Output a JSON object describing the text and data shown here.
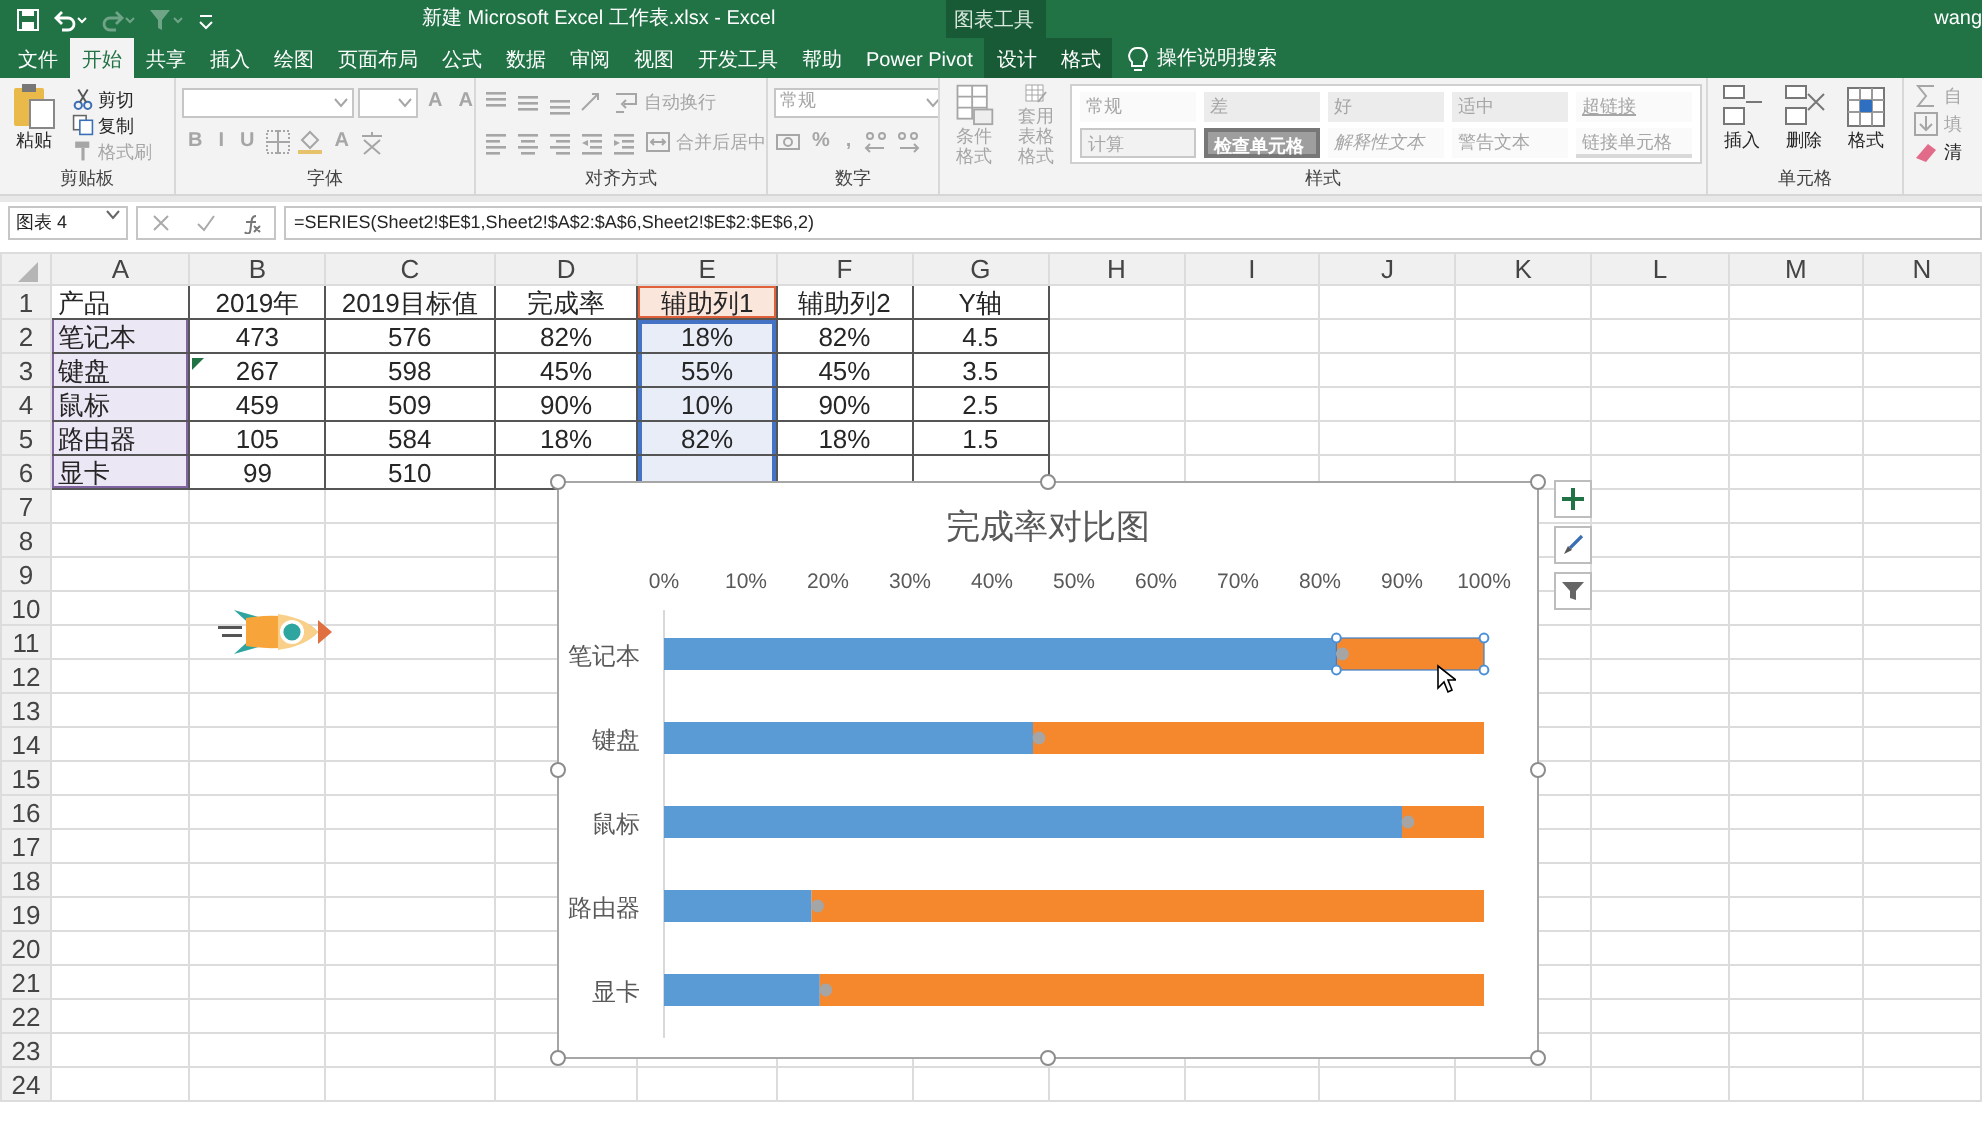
{
  "title_bar": {
    "title": "新建 Microsoft Excel 工作表.xlsx  -  Excel",
    "context_group": "图表工具",
    "user": "wang"
  },
  "quick_access": [
    {
      "kind": "save",
      "disabled": false
    },
    {
      "kind": "undo",
      "disabled": false
    },
    {
      "kind": "redo",
      "disabled": true
    },
    {
      "kind": "filter",
      "disabled": true
    },
    {
      "kind": "customize",
      "disabled": false
    }
  ],
  "tabs": [
    {
      "label": "文件",
      "selected": false,
      "contextual": false
    },
    {
      "label": "开始",
      "selected": true,
      "contextual": false
    },
    {
      "label": "共享",
      "selected": false,
      "contextual": false
    },
    {
      "label": "插入",
      "selected": false,
      "contextual": false
    },
    {
      "label": "绘图",
      "selected": false,
      "contextual": false
    },
    {
      "label": "页面布局",
      "selected": false,
      "contextual": false
    },
    {
      "label": "公式",
      "selected": false,
      "contextual": false
    },
    {
      "label": "数据",
      "selected": false,
      "contextual": false
    },
    {
      "label": "审阅",
      "selected": false,
      "contextual": false
    },
    {
      "label": "视图",
      "selected": false,
      "contextual": false
    },
    {
      "label": "开发工具",
      "selected": false,
      "contextual": false
    },
    {
      "label": "帮助",
      "selected": false,
      "contextual": false
    },
    {
      "label": "Power Pivot",
      "selected": false,
      "contextual": false
    },
    {
      "label": "设计",
      "selected": false,
      "contextual": true
    },
    {
      "label": "格式",
      "selected": false,
      "contextual": true
    }
  ],
  "search": {
    "label": "操作说明搜索"
  },
  "ribbon": [
    {
      "label": "剪贴板",
      "blocks": [
        {
          "kind": "large",
          "label": "粘贴",
          "disabled": false
        },
        {
          "kind": "stack",
          "rows": [
            [
              {
                "kind": "small",
                "label": "剪切",
                "disabled": false
              }
            ],
            [
              {
                "kind": "small",
                "label": "复制",
                "disabled": false
              }
            ],
            [
              {
                "kind": "small",
                "label": "格式刷",
                "disabled": true
              }
            ]
          ]
        }
      ]
    },
    {
      "label": "字体",
      "blocks": [
        {
          "kind": "stack",
          "rows": [
            [
              {
                "kind": "select",
                "disabled": true
              },
              {
                "kind": "select",
                "disabled": true
              },
              {
                "kind": "glyph",
                "label": "A",
                "disabled": true
              },
              {
                "kind": "glyph",
                "label": "A",
                "disabled": true
              }
            ],
            [
              {
                "kind": "glyph",
                "label": "B",
                "disabled": true
              },
              {
                "kind": "glyph",
                "label": "I",
                "disabled": true
              },
              {
                "kind": "glyph",
                "label": "U",
                "disabled": true
              },
              {
                "kind": "icon",
                "disabled": true
              },
              {
                "kind": "icon",
                "disabled": true
              },
              {
                "kind": "glyph",
                "label": "A",
                "disabled": true
              },
              {
                "kind": "icon",
                "disabled": true
              }
            ]
          ]
        }
      ]
    },
    {
      "label": "对齐方式",
      "blocks": [
        {
          "kind": "stack",
          "rows": [
            [
              {
                "kind": "icon",
                "disabled": true
              },
              {
                "kind": "icon",
                "disabled": true
              },
              {
                "kind": "icon",
                "disabled": true
              },
              {
                "kind": "icon",
                "disabled": true
              },
              {
                "kind": "small",
                "label": "自动换行",
                "disabled": true
              }
            ],
            [
              {
                "kind": "icon",
                "disabled": true
              },
              {
                "kind": "icon",
                "disabled": true
              },
              {
                "kind": "icon",
                "disabled": true
              },
              {
                "kind": "icon",
                "disabled": true
              },
              {
                "kind": "icon",
                "disabled": true
              },
              {
                "kind": "small",
                "label": "合并后居中",
                "disabled": true
              }
            ]
          ]
        }
      ]
    },
    {
      "label": "数字",
      "blocks": [
        {
          "kind": "stack",
          "rows": [
            [
              {
                "kind": "select",
                "value": "常规",
                "disabled": true
              }
            ],
            [
              {
                "kind": "icon",
                "disabled": true
              },
              {
                "kind": "glyph",
                "label": "%",
                "disabled": true
              },
              {
                "kind": "glyph",
                "label": ",",
                "disabled": true
              },
              {
                "kind": "icon",
                "disabled": true
              },
              {
                "kind": "icon",
                "disabled": true
              }
            ]
          ]
        }
      ]
    },
    {
      "label": "样式",
      "blocks": [
        {
          "kind": "large",
          "label": "条件格式",
          "disabled": true
        },
        {
          "kind": "large",
          "label": "套用表格格式",
          "disabled": true
        },
        {
          "kind": "gallery",
          "rows": [
            [
              {
                "label": "常规",
                "kind": "normal"
              },
              {
                "label": "差",
                "kind": "bad"
              },
              {
                "label": "好",
                "kind": "good"
              },
              {
                "label": "适中",
                "kind": "neutral"
              },
              {
                "label": "超链接",
                "kind": "hyperlink"
              }
            ],
            [
              {
                "label": "计算",
                "kind": "calculation"
              },
              {
                "label": "检查单元格",
                "kind": "check"
              },
              {
                "label": "解释性文本",
                "kind": "explanatory"
              },
              {
                "label": "警告文本",
                "kind": "warning"
              },
              {
                "label": "链接单元格",
                "kind": "linked"
              }
            ]
          ]
        }
      ]
    },
    {
      "label": "单元格",
      "blocks": [
        {
          "kind": "large",
          "label": "插入",
          "disabled": false
        },
        {
          "kind": "large",
          "label": "删除",
          "disabled": false
        },
        {
          "kind": "large",
          "label": "格式",
          "disabled": false
        }
      ]
    },
    {
      "blocks": [
        {
          "kind": "stack",
          "rows": [
            [
              {
                "kind": "small",
                "label": "自",
                "disabled": true
              }
            ],
            [
              {
                "kind": "small",
                "label": "填",
                "disabled": true
              }
            ],
            [
              {
                "kind": "small",
                "label": "清",
                "disabled": false
              }
            ]
          ]
        }
      ]
    }
  ],
  "formula_bar": {
    "name_box": "图表 4",
    "formula": "=SERIES(Sheet2!$E$1,Sheet2!$A$2:$A$6,Sheet2!$E$2:$E$6,2)"
  },
  "sheet": {
    "columns": [
      {
        "label": "A",
        "category_range": true
      },
      {
        "label": "B"
      },
      {
        "label": "C"
      },
      {
        "label": "D"
      },
      {
        "label": "E",
        "value_range": true
      },
      {
        "label": "F"
      },
      {
        "label": "G"
      },
      {
        "label": "H"
      },
      {
        "label": "I"
      },
      {
        "label": "J"
      },
      {
        "label": "K"
      },
      {
        "label": "L"
      },
      {
        "label": "M"
      },
      {
        "label": "N"
      }
    ],
    "rows": [
      "1",
      "2",
      "3",
      "4",
      "5",
      "6",
      "7",
      "8",
      "9",
      "10",
      "11",
      "12",
      "13",
      "14",
      "15",
      "16",
      "17",
      "18",
      "19",
      "20",
      "21",
      "22",
      "23",
      "24"
    ],
    "cells": [
      [
        "产品",
        "2019年",
        "2019目标值",
        "完成率",
        "辅助列1",
        "辅助列2",
        "Y轴"
      ],
      [
        "笔记本",
        "473",
        "576",
        "82%",
        "18%",
        "82%",
        "4.5"
      ],
      [
        "键盘",
        "267",
        "598",
        "45%",
        "55%",
        "45%",
        "3.5"
      ],
      [
        "鼠标",
        "459",
        "509",
        "90%",
        "10%",
        "90%",
        "2.5"
      ],
      [
        "路由器",
        "105",
        "584",
        "18%",
        "82%",
        "18%",
        "1.5"
      ],
      [
        "显卡",
        "99",
        "510"
      ]
    ]
  },
  "chart": {
    "selected": true,
    "point_selected": [
      [
        false,
        false,
        false,
        false,
        false
      ],
      [
        true,
        false,
        false,
        false,
        false
      ]
    ],
    "chart_data": {
      "type": "bar",
      "orientation": "horizontal",
      "stacked": true,
      "title": "完成率对比图",
      "categories": [
        "笔记本",
        "键盘",
        "鼠标",
        "路由器",
        "显卡"
      ],
      "series": [
        {
          "color": "#5b9bd5",
          "values": [
            0.82,
            0.45,
            0.9,
            0.18,
            0.19
          ]
        },
        {
          "color": "#f5882c",
          "values": [
            0.18,
            0.55,
            0.1,
            0.82,
            0.81
          ]
        }
      ],
      "xlim": [
        0,
        1
      ],
      "xticks": [
        {
          "value": 0,
          "label": "0%"
        },
        {
          "value": 0.1,
          "label": "10%"
        },
        {
          "value": 0.2,
          "label": "20%"
        },
        {
          "value": 0.3,
          "label": "30%"
        },
        {
          "value": 0.4,
          "label": "40%"
        },
        {
          "value": 0.5,
          "label": "50%"
        },
        {
          "value": 0.6,
          "label": "60%"
        },
        {
          "value": 0.7,
          "label": "70%"
        },
        {
          "value": 0.8,
          "label": "80%"
        },
        {
          "value": 0.9,
          "label": "90%"
        },
        {
          "value": 1,
          "label": "100%"
        }
      ]
    }
  }
}
